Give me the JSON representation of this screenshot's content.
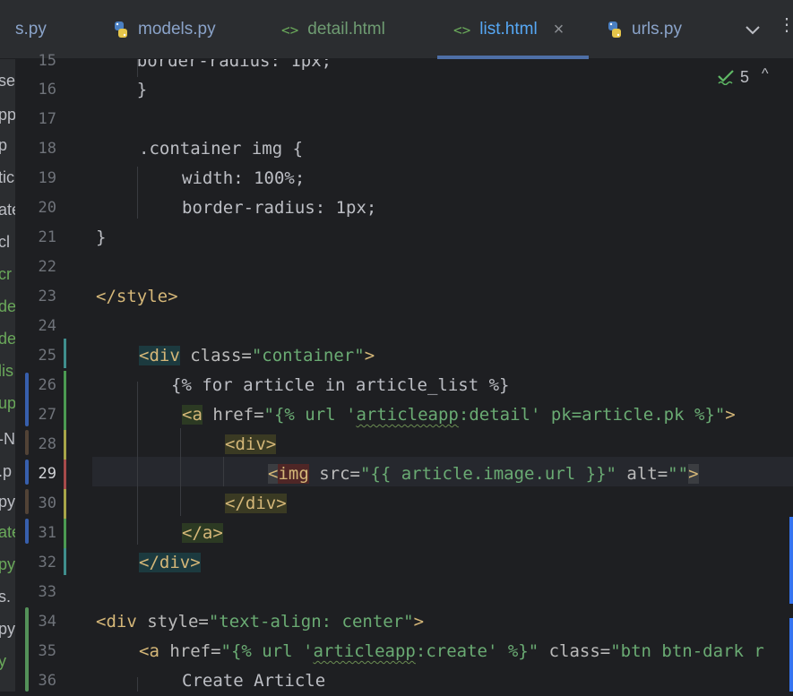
{
  "tabs": [
    {
      "label": "s.py",
      "type": "py",
      "active": false
    },
    {
      "label": "models.py",
      "type": "py",
      "active": false
    },
    {
      "label": "detail.html",
      "type": "html",
      "active": false
    },
    {
      "label": "list.html",
      "type": "html",
      "active": true
    },
    {
      "label": "urls.py",
      "type": "py",
      "active": false
    }
  ],
  "tab_close_symbol": "×",
  "more_symbol": "⋮",
  "html_icon_glyph": "<>",
  "inspections": {
    "count": "5",
    "up_symbol": "^"
  },
  "project_strip": [
    "se",
    "pp",
    "p",
    "tic",
    "ate",
    "cl",
    "cr",
    "de",
    "de",
    "lis",
    "up",
    "-N",
    ".p",
    "py",
    "ate",
    "py",
    "s.",
    "py",
    "y"
  ],
  "line_numbers": [
    "15",
    "16",
    "17",
    "18",
    "19",
    "20",
    "21",
    "22",
    "23",
    "24",
    "25",
    "26",
    "27",
    "28",
    "29",
    "30",
    "31",
    "32",
    "33",
    "34",
    "35",
    "36"
  ],
  "current_line": "29",
  "code": {
    "l15": "    border-radius: 1px;",
    "l16": "    }",
    "l18_sel": ".container img {",
    "l19": "width: 100%;",
    "l20": "border-radius: 1px;",
    "l21": "}",
    "l23": "</style>",
    "l25_open": "<div",
    "l25_attr": " class=",
    "l25_val": "\"container\"",
    "l25_close": ">",
    "l26": "{% for article in article_list %}",
    "l27_open": "<a",
    "l27_attr": " href=",
    "l27_val1": "\"{% url '",
    "l27_val2": "articleapp",
    "l27_val3": ":detail' pk=article.pk %}\"",
    "l27_close": ">",
    "l28": "<div>",
    "l29_lt": "<",
    "l29_tag": "img",
    "l29_attr1": " src=",
    "l29_val1": "\"{{ article.image.url }}\"",
    "l29_attr2": " alt=",
    "l29_val2": "\"\"",
    "l29_close": ">",
    "l30": "</div>",
    "l31": "</a>",
    "l32": "</div>",
    "l34_open": "<div",
    "l34_attr": " style=",
    "l34_val": "\"text-align: center\"",
    "l34_close": ">",
    "l35_open": "<a",
    "l35_attr": " href=",
    "l35_val1": "\"{% url '",
    "l35_val2": "articleapp",
    "l35_val3": ":create' %}\"",
    "l35_attr2": " class=",
    "l35_val4": "\"btn btn-dark r",
    "l36": "Create Article"
  }
}
